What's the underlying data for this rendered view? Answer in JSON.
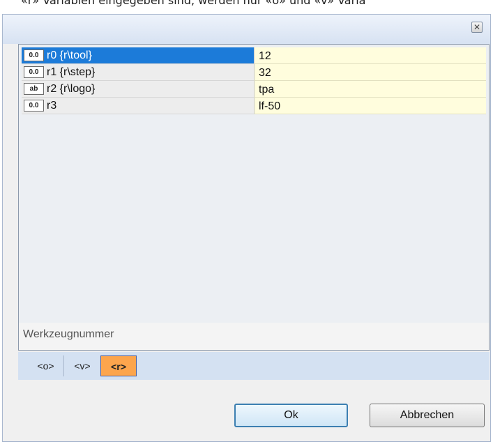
{
  "top_text": "«r» Variablen eingegeben sind, werden nur «o» und «v» Varia",
  "dialog": {
    "close_label": "✕"
  },
  "rows": [
    {
      "type": "0.0",
      "name": "r0 {r\\tool}",
      "value": "12",
      "selected": true
    },
    {
      "type": "0.0",
      "name": "r1 {r\\step}",
      "value": "32",
      "selected": false
    },
    {
      "type": "ab",
      "name": "r2 {r\\logo}",
      "value": "tpa",
      "selected": false
    },
    {
      "type": "0.0",
      "name": "r3",
      "value": "lf-50",
      "selected": false
    }
  ],
  "splitter": {
    "handle": "▾ ·········· ▾"
  },
  "description": "Werkzeugnummer",
  "tabs": [
    {
      "label": "<o>",
      "active": false
    },
    {
      "label": "<v>",
      "active": false
    },
    {
      "label": "<r>",
      "active": true
    }
  ],
  "buttons": {
    "ok": "Ok",
    "cancel": "Abbrechen"
  },
  "colors": {
    "selected_row": "#1c7bd9",
    "value_background": "#fffddd",
    "active_tab": "#fca54d",
    "header_gradient_bottom": "#d7e2f2"
  }
}
